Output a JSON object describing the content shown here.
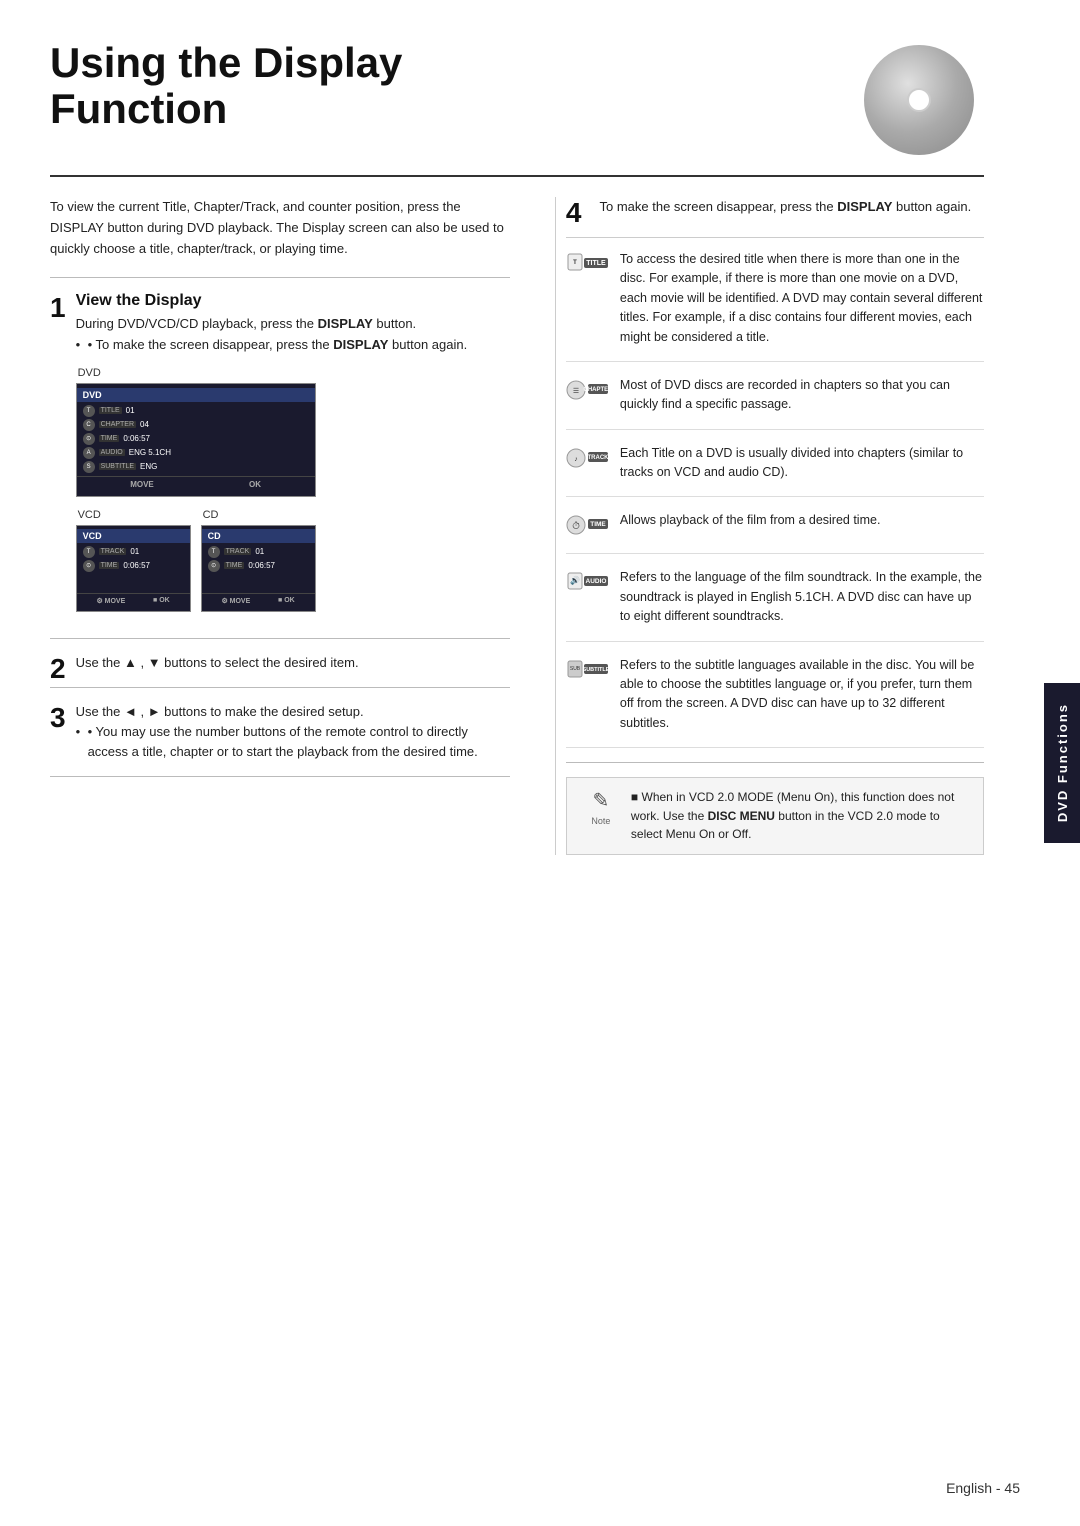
{
  "page": {
    "title_line1": "Using the Display",
    "title_line2": "Function",
    "sidebar_label": "DVD Functions",
    "page_number": "English - 45"
  },
  "intro": {
    "text": "To view the current Title, Chapter/Track, and counter position, press the DISPLAY button during DVD playback. The Display screen can also be used to quickly choose a title, chapter/track, or playing time."
  },
  "steps": {
    "step1": {
      "number": "1",
      "title": "View the Display",
      "text1": "During DVD/VCD/CD playback, press the",
      "bold1": "DISPLAY",
      "text1b": " button.",
      "bullet1_pre": "• To make the screen disappear, press the ",
      "bullet1_bold": "DISPLAY",
      "bullet1_post": " button again."
    },
    "step2": {
      "number": "2",
      "text": "Use the ▲ , ▼ buttons to select the desired item."
    },
    "step3": {
      "number": "3",
      "text1": "Use the ◄ , ► buttons to make the desired setup.",
      "bullet1": "• You may use the number buttons of the remote control to directly access a title, chapter or to start the playback from the desired time."
    },
    "step4": {
      "number": "4",
      "text_pre": "To make the screen disappear, press the ",
      "bold": "DISPLAY",
      "text_post": " button again."
    }
  },
  "mockups": {
    "dvd_label": "DVD",
    "vcd_label": "VCD",
    "cd_label": "CD",
    "dvd_header": "DVD",
    "dvd_rows": [
      {
        "icon": "T",
        "label": "TITLE",
        "value": "01"
      },
      {
        "icon": "C",
        "label": "CHAPTER",
        "value": "04"
      },
      {
        "icon": "⊙",
        "label": "TIME",
        "value": "0:06:57"
      },
      {
        "icon": "A",
        "label": "AUDIO",
        "value": "ENG 5.1CH"
      },
      {
        "icon": "S",
        "label": "SUBTITLE",
        "value": "ENG"
      }
    ],
    "dvd_footer_move": "MOVE",
    "dvd_footer_ok": "OK",
    "vcd_header": "VCD",
    "vcd_rows": [
      {
        "icon": "T",
        "label": "TRACK",
        "value": "01"
      },
      {
        "icon": "⊙",
        "label": "TIME",
        "value": "0:06:57"
      }
    ],
    "vcd_footer_move": "MOVE",
    "vcd_footer_ok": "OK",
    "cd_header": "CD",
    "cd_rows": [
      {
        "icon": "T",
        "label": "TRACK",
        "value": "01"
      },
      {
        "icon": "⊙",
        "label": "TIME",
        "value": "0:06:57"
      }
    ],
    "cd_footer_move": "MOVE",
    "cd_footer_ok": "OK"
  },
  "info_items": [
    {
      "id": "title",
      "badge": "TITLE",
      "icon_char": "T",
      "text": "To access the desired title when there is more than one in the disc. For example, if there is more than one movie on a DVD, each movie will be identified. A DVD may contain several different titles. For example, if a disc contains four different movies, each might be considered a title."
    },
    {
      "id": "chapter",
      "badge": "CHAPTER",
      "icon_char": "CH",
      "text": "Most of DVD discs are recorded in chapters so that you can quickly find a specific passage."
    },
    {
      "id": "track",
      "badge": "TRACK",
      "icon_char": "TR",
      "text": "Each Title on a DVD is usually divided into chapters (similar to tracks on VCD and audio CD)."
    },
    {
      "id": "time",
      "badge": "TIME",
      "icon_char": "⏱",
      "text": "Allows playback of the film from a desired time."
    },
    {
      "id": "audio",
      "badge": "AUDIO",
      "icon_char": "A",
      "text": "Refers to the language of the film soundtrack. In the example, the soundtrack is played in English 5.1CH. A DVD disc can have up to eight different soundtracks."
    },
    {
      "id": "subtitle",
      "badge": "SUBTITLE",
      "icon_char": "S",
      "text": "Refers to the subtitle languages available in the disc. You will be able to choose the subtitles language or, if you prefer, turn them off from the screen. A DVD disc can have up to 32 different subtitles."
    }
  ],
  "note": {
    "label": "Note",
    "icon": "✎",
    "text_pre": "■  When in VCD 2.0 MODE (Menu On), this function does not work. Use the ",
    "bold": "DISC MENU",
    "text_post": " button in the VCD 2.0 mode to select Menu On or Off."
  }
}
